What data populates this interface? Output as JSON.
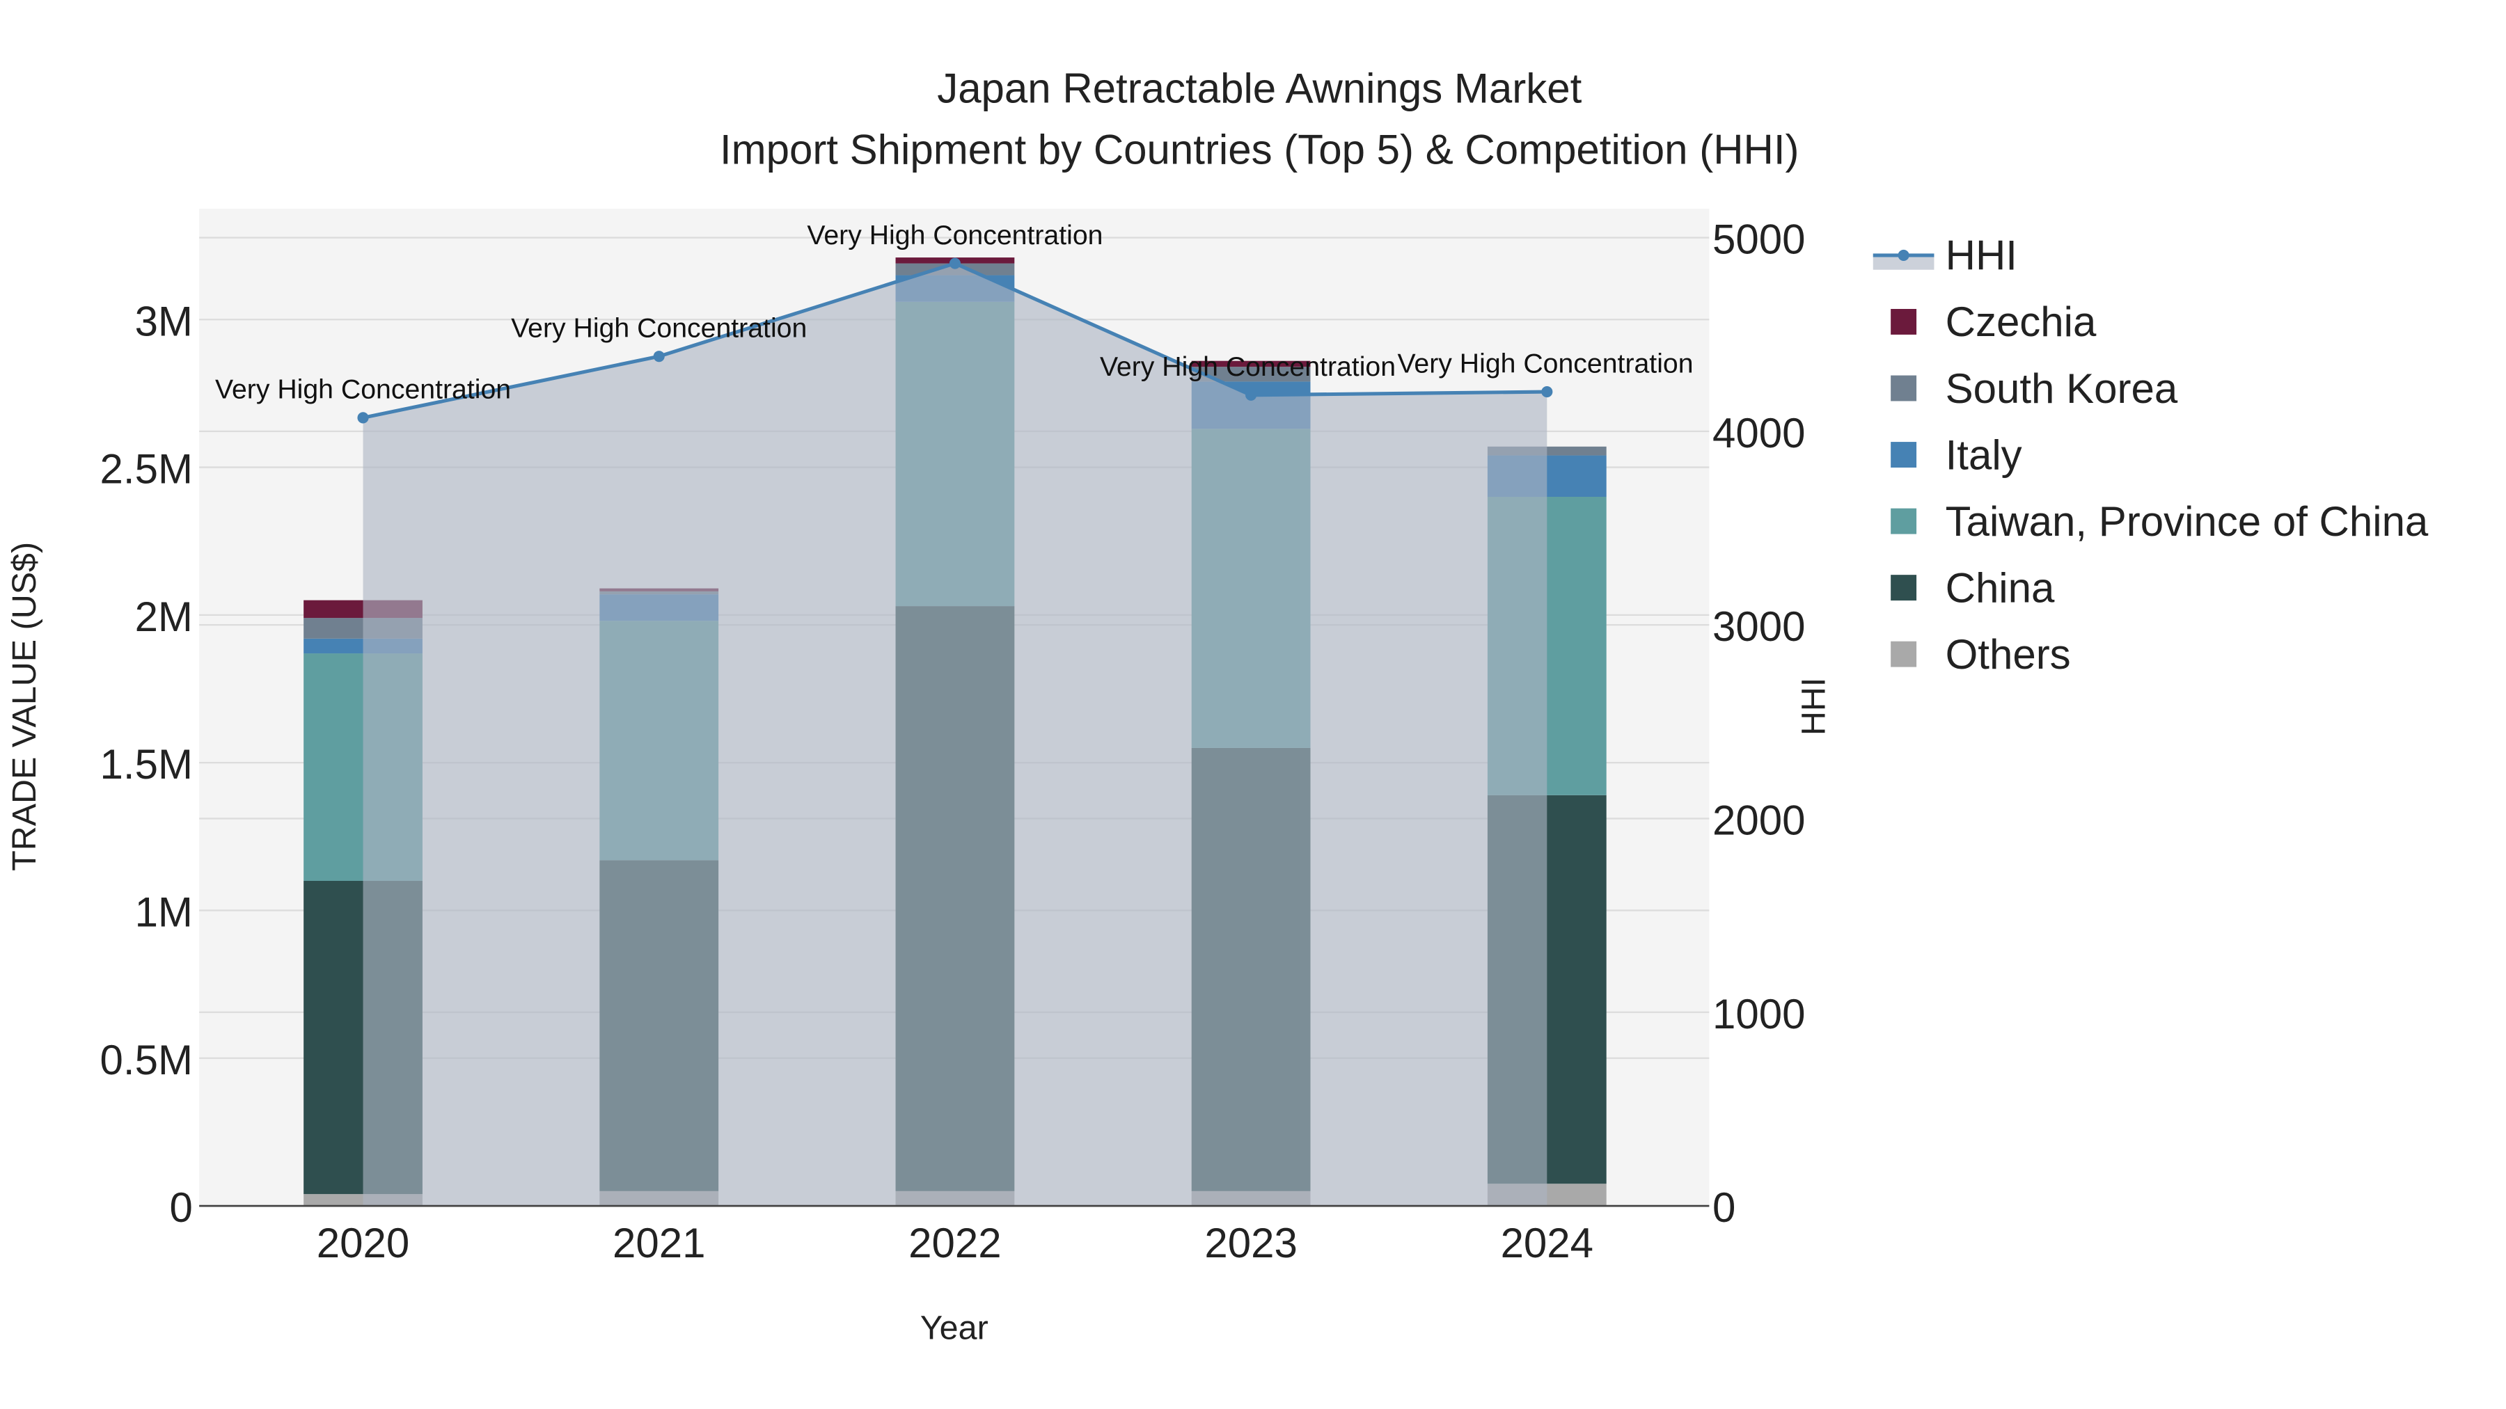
{
  "chart_data": {
    "type": "bar",
    "title": "Japan Retractable Awnings Market",
    "subtitle": "Import Shipment by Countries (Top 5) & Competition (HHI)",
    "xlabel": "Year",
    "ylabel": "TRADE VALUE (US$)",
    "y2label": "HHI",
    "categories": [
      "2020",
      "2021",
      "2022",
      "2023",
      "2024"
    ],
    "ylim": [
      0,
      3300000
    ],
    "y2lim": [
      0,
      5130
    ],
    "yticks": [
      {
        "v": 0,
        "label": "0"
      },
      {
        "v": 500000,
        "label": "0.5M"
      },
      {
        "v": 1000000,
        "label": "1M"
      },
      {
        "v": 1500000,
        "label": "1.5M"
      },
      {
        "v": 2000000,
        "label": "2M"
      },
      {
        "v": 2500000,
        "label": "2.5M"
      },
      {
        "v": 3000000,
        "label": "3M"
      }
    ],
    "y2ticks": [
      {
        "v": 0,
        "label": "0"
      },
      {
        "v": 1000,
        "label": "1000"
      },
      {
        "v": 2000,
        "label": "2000"
      },
      {
        "v": 3000,
        "label": "3000"
      },
      {
        "v": 4000,
        "label": "4000"
      },
      {
        "v": 5000,
        "label": "5000"
      }
    ],
    "stacked": true,
    "series": [
      {
        "name": "Others",
        "color": "#a9a9a9",
        "values": [
          40000,
          50000,
          50000,
          50000,
          75000
        ]
      },
      {
        "name": "China",
        "color": "#2f4f4f",
        "values": [
          1060000,
          1120000,
          1980000,
          1500000,
          1315000
        ]
      },
      {
        "name": "Taiwan, Province of China",
        "color": "#5f9ea0",
        "values": [
          770000,
          810000,
          1030000,
          1080000,
          1010000
        ]
      },
      {
        "name": "Italy",
        "color": "#4682b4",
        "values": [
          50000,
          90000,
          90000,
          160000,
          140000
        ]
      },
      {
        "name": "South Korea",
        "color": "#708090",
        "values": [
          70000,
          10000,
          40000,
          50000,
          30000
        ]
      },
      {
        "name": "Czechia",
        "color": "#6b1a3c",
        "values": [
          60000,
          10000,
          20000,
          20000,
          0
        ]
      }
    ],
    "line": {
      "name": "HHI",
      "color": "#4682b4",
      "fill": "rgba(172,180,196,0.62)",
      "values": [
        4070,
        4387,
        4867,
        4187,
        4204
      ],
      "annotations": [
        "Very High Concentration",
        "Very High Concentration",
        "Very High Concentration",
        "Very High Concentration",
        "Very High Concentration"
      ]
    },
    "legend": {
      "position": "right",
      "order": [
        "HHI",
        "Czechia",
        "South Korea",
        "Italy",
        "Taiwan, Province of China",
        "China",
        "Others"
      ]
    },
    "grid": true
  }
}
